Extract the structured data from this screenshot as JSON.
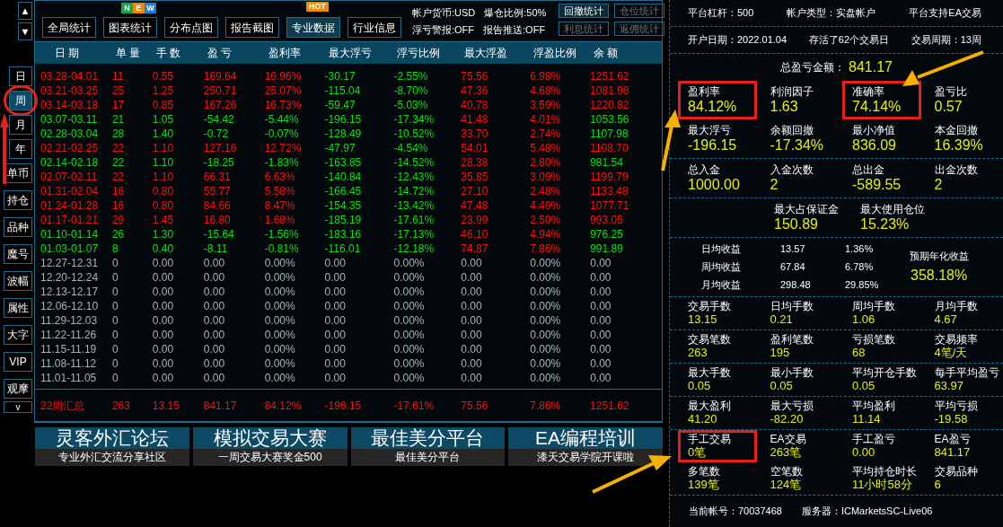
{
  "side_nav": {
    "scroll": [
      "▲",
      "▼"
    ],
    "periods": [
      {
        "label": "日",
        "selected": false,
        "circled": false
      },
      {
        "label": "周",
        "selected": true,
        "circled": true
      },
      {
        "label": "月",
        "selected": false,
        "circled": false
      },
      {
        "label": "年",
        "selected": false,
        "circled": false
      }
    ],
    "tools": [
      "单币",
      "持仓",
      "品种",
      "魔号",
      "波幅",
      "属性",
      "大字",
      "VIP",
      "观摩"
    ],
    "more": "v"
  },
  "toolbar": {
    "buttons": [
      {
        "label": "全局统计",
        "selected": false
      },
      {
        "label": "图表统计",
        "selected": false,
        "badge": {
          "kind": "new",
          "letters": [
            "N",
            "E",
            "W"
          ]
        }
      },
      {
        "label": "分布点图",
        "selected": false
      },
      {
        "label": "报告截图",
        "selected": false
      },
      {
        "label": "专业数据",
        "selected": true,
        "badge": {
          "kind": "hot",
          "text": "HOT"
        }
      },
      {
        "label": "行业信息",
        "selected": false
      }
    ],
    "account_info": [
      [
        "帐户货币:USD",
        "爆仓比例:50%"
      ],
      [
        "浮亏警报:OFF",
        "报告推送:OFF"
      ]
    ],
    "stat_buttons": [
      {
        "label": "回撤统计",
        "disabled": false
      },
      {
        "label": "仓位统计",
        "disabled": true
      },
      {
        "label": "利息统计",
        "disabled": true
      },
      {
        "label": "返佣统计",
        "disabled": true
      }
    ]
  },
  "table": {
    "columns": [
      "日 期",
      "单 量",
      "手 数",
      "盈 亏",
      "盈利率",
      "最大浮亏",
      "浮亏比例",
      "最大浮盈",
      "浮盈比例",
      "余 额"
    ],
    "rows": [
      {
        "kind": "profit",
        "balance_up": true,
        "cells": [
          "03.28-04.01",
          "11",
          "0.55",
          "169.64",
          "16.96%",
          "-30.17",
          "-2.55%",
          "75.56",
          "6.98%",
          "1251.62"
        ]
      },
      {
        "kind": "profit",
        "balance_up": true,
        "cells": [
          "03.21-03.25",
          "25",
          "1.25",
          "250.71",
          "25.07%",
          "-115.04",
          "-8.70%",
          "47.36",
          "4.68%",
          "1081.98"
        ]
      },
      {
        "kind": "profit",
        "balance_up": true,
        "cells": [
          "03.14-03.18",
          "17",
          "0.85",
          "167.26",
          "16.73%",
          "-59.47",
          "-5.03%",
          "40.78",
          "3.59%",
          "1220.82"
        ]
      },
      {
        "kind": "loss",
        "balance_up": false,
        "cells": [
          "03.07-03.11",
          "21",
          "1.05",
          "-54.42",
          "-5.44%",
          "-196.15",
          "-17.34%",
          "41.48",
          "4.01%",
          "1053.56"
        ]
      },
      {
        "kind": "loss",
        "balance_up": false,
        "cells": [
          "02.28-03.04",
          "28",
          "1.40",
          "-0.72",
          "-0.07%",
          "-128.49",
          "-10.52%",
          "33.70",
          "2.74%",
          "1107.98"
        ]
      },
      {
        "kind": "profit",
        "balance_up": true,
        "cells": [
          "02.21-02.25",
          "22",
          "1.10",
          "127.16",
          "12.72%",
          "-47.97",
          "-4.54%",
          "54.01",
          "5.48%",
          "1108.70"
        ]
      },
      {
        "kind": "loss",
        "balance_up": false,
        "cells": [
          "02.14-02.18",
          "22",
          "1.10",
          "-18.25",
          "-1.83%",
          "-163.85",
          "-14.52%",
          "28.38",
          "2.80%",
          "981.54"
        ]
      },
      {
        "kind": "profit",
        "balance_up": true,
        "cells": [
          "02.07-02.11",
          "22",
          "1.10",
          "66.31",
          "6.63%",
          "-140.84",
          "-12.43%",
          "35.85",
          "3.09%",
          "1199.79"
        ]
      },
      {
        "kind": "profit",
        "balance_up": true,
        "cells": [
          "01.31-02.04",
          "16",
          "0.80",
          "55.77",
          "5.58%",
          "-166.45",
          "-14.72%",
          "27.10",
          "2.48%",
          "1133.48"
        ]
      },
      {
        "kind": "profit",
        "balance_up": true,
        "cells": [
          "01.24-01.28",
          "16",
          "0.80",
          "84.66",
          "8.47%",
          "-154.35",
          "-13.42%",
          "47.48",
          "4.49%",
          "1077.71"
        ]
      },
      {
        "kind": "profit",
        "balance_up": true,
        "cells": [
          "01.17-01.21",
          "29",
          "1.45",
          "16.80",
          "1.68%",
          "-185.19",
          "-17.61%",
          "23.99",
          "2.50%",
          "993.05"
        ]
      },
      {
        "kind": "loss",
        "balance_up": false,
        "cells": [
          "01.10-01.14",
          "26",
          "1.30",
          "-15.64",
          "-1.56%",
          "-183.16",
          "-17.13%",
          "46.10",
          "4.94%",
          "976.25"
        ]
      },
      {
        "kind": "loss",
        "balance_up": false,
        "cells": [
          "01.03-01.07",
          "8",
          "0.40",
          "-8.11",
          "-0.81%",
          "-116.01",
          "-12.18%",
          "74.87",
          "7.86%",
          "991.89"
        ]
      },
      {
        "kind": "empty",
        "cells": [
          "12.27-12.31",
          "0",
          "0.00",
          "0.00",
          "0.00%",
          "0.00",
          "0.00%",
          "0.00",
          "0.00%",
          "0.00"
        ]
      },
      {
        "kind": "empty",
        "cells": [
          "12.20-12.24",
          "0",
          "0.00",
          "0.00",
          "0.00%",
          "0.00",
          "0.00%",
          "0.00",
          "0.00%",
          "0.00"
        ]
      },
      {
        "kind": "empty",
        "cells": [
          "12.13-12.17",
          "0",
          "0.00",
          "0.00",
          "0.00%",
          "0.00",
          "0.00%",
          "0.00",
          "0.00%",
          "0.00"
        ]
      },
      {
        "kind": "empty",
        "cells": [
          "12.06-12.10",
          "0",
          "0.00",
          "0.00",
          "0.00%",
          "0.00",
          "0.00%",
          "0.00",
          "0.00%",
          "0.00"
        ]
      },
      {
        "kind": "empty",
        "cells": [
          "11.29-12.03",
          "0",
          "0.00",
          "0.00",
          "0.00%",
          "0.00",
          "0.00%",
          "0.00",
          "0.00%",
          "0.00"
        ]
      },
      {
        "kind": "empty",
        "cells": [
          "11.22-11.26",
          "0",
          "0.00",
          "0.00",
          "0.00%",
          "0.00",
          "0.00%",
          "0.00",
          "0.00%",
          "0.00"
        ]
      },
      {
        "kind": "empty",
        "cells": [
          "11.15-11.19",
          "0",
          "0.00",
          "0.00",
          "0.00%",
          "0.00",
          "0.00%",
          "0.00",
          "0.00%",
          "0.00"
        ]
      },
      {
        "kind": "empty",
        "cells": [
          "11.08-11.12",
          "0",
          "0.00",
          "0.00",
          "0.00%",
          "0.00",
          "0.00%",
          "0.00",
          "0.00%",
          "0.00"
        ]
      },
      {
        "kind": "empty",
        "cells": [
          "11.01-11.05",
          "0",
          "0.00",
          "0.00",
          "0.00%",
          "0.00",
          "0.00%",
          "0.00",
          "0.00%",
          "0.00"
        ]
      }
    ],
    "summary": [
      "22周汇总",
      "263",
      "13.15",
      "841.17",
      "84.12%",
      "-196.15",
      "-17.61%",
      "75.56",
      "7.86%",
      "1251.62"
    ]
  },
  "banners": [
    {
      "title": "灵客外汇论坛",
      "subtitle": "专业外汇交流分享社区"
    },
    {
      "title": "模拟交易大赛",
      "subtitle": "一周交易大赛奖金500"
    },
    {
      "title": "最佳美分平台",
      "subtitle": "最佳美分平台"
    },
    {
      "title": "EA编程培训",
      "subtitle": "漆天交易学院开课啦"
    }
  ],
  "summary_panel": {
    "info_lines": [
      [
        "平台杠杆：500",
        "帐户类型：实盘帐户",
        "平台支持EA交易"
      ],
      [
        "开户日期：2022.01.04",
        "存活了62个交易日",
        "交易周期：13周"
      ]
    ],
    "total": {
      "label": "总盈亏金额：",
      "value": "841.17"
    },
    "metric_groups": [
      {
        "rows": [
          [
            {
              "label": "盈利率",
              "value": "84.12%",
              "highlighted": true
            },
            {
              "label": "利润因子",
              "value": "1.63",
              "highlighted": false
            },
            {
              "label": "准确率",
              "value": "74.14%",
              "highlighted": true
            },
            {
              "label": "盈亏比",
              "value": "0.57",
              "highlighted": false
            }
          ],
          [
            {
              "label": "最大浮亏",
              "value": "-196.15",
              "highlighted": false
            },
            {
              "label": "余额回撤",
              "value": "-17.34%",
              "highlighted": false
            },
            {
              "label": "最小净值",
              "value": "836.09",
              "highlighted": false
            },
            {
              "label": "本金回撤",
              "value": "16.39%",
              "highlighted": false
            }
          ]
        ]
      },
      {
        "rows": [
          [
            {
              "label": "总入金",
              "value": "1000.00",
              "highlighted": false
            },
            {
              "label": "入金次数",
              "value": "2",
              "highlighted": false
            },
            {
              "label": "总出金",
              "value": "-589.55",
              "highlighted": false
            },
            {
              "label": "出金次数",
              "value": "2",
              "highlighted": false
            }
          ]
        ]
      },
      {
        "rows": [
          [
            {
              "label": "最大占保证金",
              "value": "150.89",
              "highlighted": false
            },
            {
              "label": "最大使用仓位",
              "value": "15.23%",
              "highlighted": false
            }
          ]
        ]
      }
    ],
    "averages": {
      "rows": [
        {
          "label": "日均收益",
          "amount": "13.57",
          "percent": "1.36%"
        },
        {
          "label": "周均收益",
          "amount": "67.84",
          "percent": "6.78%"
        },
        {
          "label": "月均收益",
          "amount": "298.48",
          "percent": "29.85%"
        }
      ],
      "forecast": {
        "label": "预期年化收益",
        "value": "358.18%"
      }
    },
    "trade_groups": [
      {
        "rows": [
          [
            {
              "label": "交易手数",
              "value": "13.15",
              "highlighted": false
            },
            {
              "label": "日均手数",
              "value": "0.21",
              "highlighted": false
            },
            {
              "label": "周均手数",
              "value": "1.06",
              "highlighted": false
            },
            {
              "label": "月均手数",
              "value": "4.67",
              "highlighted": false
            }
          ]
        ]
      },
      {
        "rows": [
          [
            {
              "label": "交易笔数",
              "value": "263",
              "highlighted": false
            },
            {
              "label": "盈利笔数",
              "value": "195",
              "highlighted": false
            },
            {
              "label": "亏损笔数",
              "value": "68",
              "highlighted": false
            },
            {
              "label": "交易频率",
              "value": "4笔/天",
              "highlighted": false
            }
          ]
        ]
      },
      {
        "rows": [
          [
            {
              "label": "最大手数",
              "value": "0.05",
              "highlighted": false
            },
            {
              "label": "最小手数",
              "value": "0.05",
              "highlighted": false
            },
            {
              "label": "平均开仓手数",
              "value": "0.05",
              "highlighted": false
            },
            {
              "label": "每手平均盈亏",
              "value": "63.97",
              "highlighted": false
            }
          ]
        ]
      },
      {
        "rows": [
          [
            {
              "label": "最大盈利",
              "value": "41.20",
              "highlighted": false
            },
            {
              "label": "最大亏损",
              "value": "-82.20",
              "highlighted": false
            },
            {
              "label": "平均盈利",
              "value": "11.14",
              "highlighted": false
            },
            {
              "label": "平均亏损",
              "value": "-19.58",
              "highlighted": false
            }
          ]
        ]
      },
      {
        "rows": [
          [
            {
              "label": "手工交易",
              "value": "0笔",
              "highlighted": true
            },
            {
              "label": "EA交易",
              "value": "263笔",
              "highlighted": false
            },
            {
              "label": "手工盈亏",
              "value": "0.00",
              "highlighted": false
            },
            {
              "label": "EA盈亏",
              "value": "841.17",
              "highlighted": false
            }
          ],
          [
            {
              "label": "多笔数",
              "value": "139笔",
              "highlighted": false
            },
            {
              "label": "空笔数",
              "value": "124笔",
              "highlighted": false
            },
            {
              "label": "平均持仓时长",
              "value": "11小时58分",
              "highlighted": false
            },
            {
              "label": "交易品种",
              "value": "6",
              "highlighted": false
            }
          ]
        ]
      }
    ],
    "footer": [
      "当前帐号：70037468",
      "服务器：ICMarketsSC-Live06"
    ]
  }
}
